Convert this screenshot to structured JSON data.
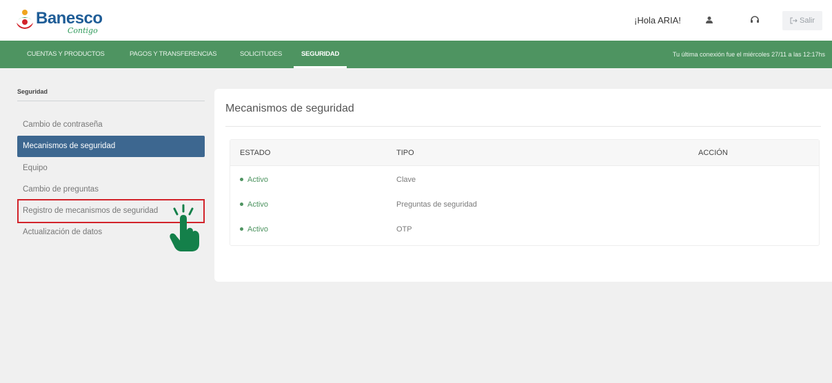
{
  "header": {
    "brand": "Banesco",
    "tagline": "Contigo",
    "greeting": "¡Hola ARIA!",
    "user_icon": "user-icon",
    "support_icon": "headset-icon",
    "logout_icon": "logout-icon",
    "logout_label": "Salir"
  },
  "nav": {
    "tabs": [
      {
        "label": "CUENTAS Y PRODUCTOS",
        "active": false
      },
      {
        "label": "PAGOS Y TRANSFERENCIAS",
        "active": false
      },
      {
        "label": "SOLICITUDES",
        "active": false
      },
      {
        "label": "SEGURIDAD",
        "active": true
      }
    ],
    "last_connection": "Tu última conexión fue el miércoles 27/11 a las 12:17hs"
  },
  "sidebar": {
    "title": "Seguridad",
    "items": [
      {
        "label": "Cambio de contraseña",
        "state": "normal"
      },
      {
        "label": "Mecanismos de seguridad",
        "state": "active"
      },
      {
        "label": "Equipo",
        "state": "normal"
      },
      {
        "label": "Cambio de preguntas",
        "state": "normal"
      },
      {
        "label": "Registro de mecanismos de seguridad",
        "state": "highlighted"
      },
      {
        "label": "Actualización de datos",
        "state": "normal"
      }
    ]
  },
  "annotation": {
    "icon": "tap-hand-icon"
  },
  "main": {
    "title": "Mecanismos de seguridad",
    "table": {
      "headers": [
        "ESTADO",
        "TIPO",
        "ACCIÓN"
      ],
      "rows": [
        {
          "estado": "Activo",
          "tipo": "Clave",
          "accion": ""
        },
        {
          "estado": "Activo",
          "tipo": "Preguntas de seguridad",
          "accion": ""
        },
        {
          "estado": "Activo",
          "tipo": "OTP",
          "accion": ""
        }
      ]
    }
  },
  "colors": {
    "brand_green": "#4e9461",
    "brand_blue": "#1f5d97",
    "active_item": "#3d6790",
    "highlight_border": "#d2232a",
    "hand_green": "#14804a"
  }
}
